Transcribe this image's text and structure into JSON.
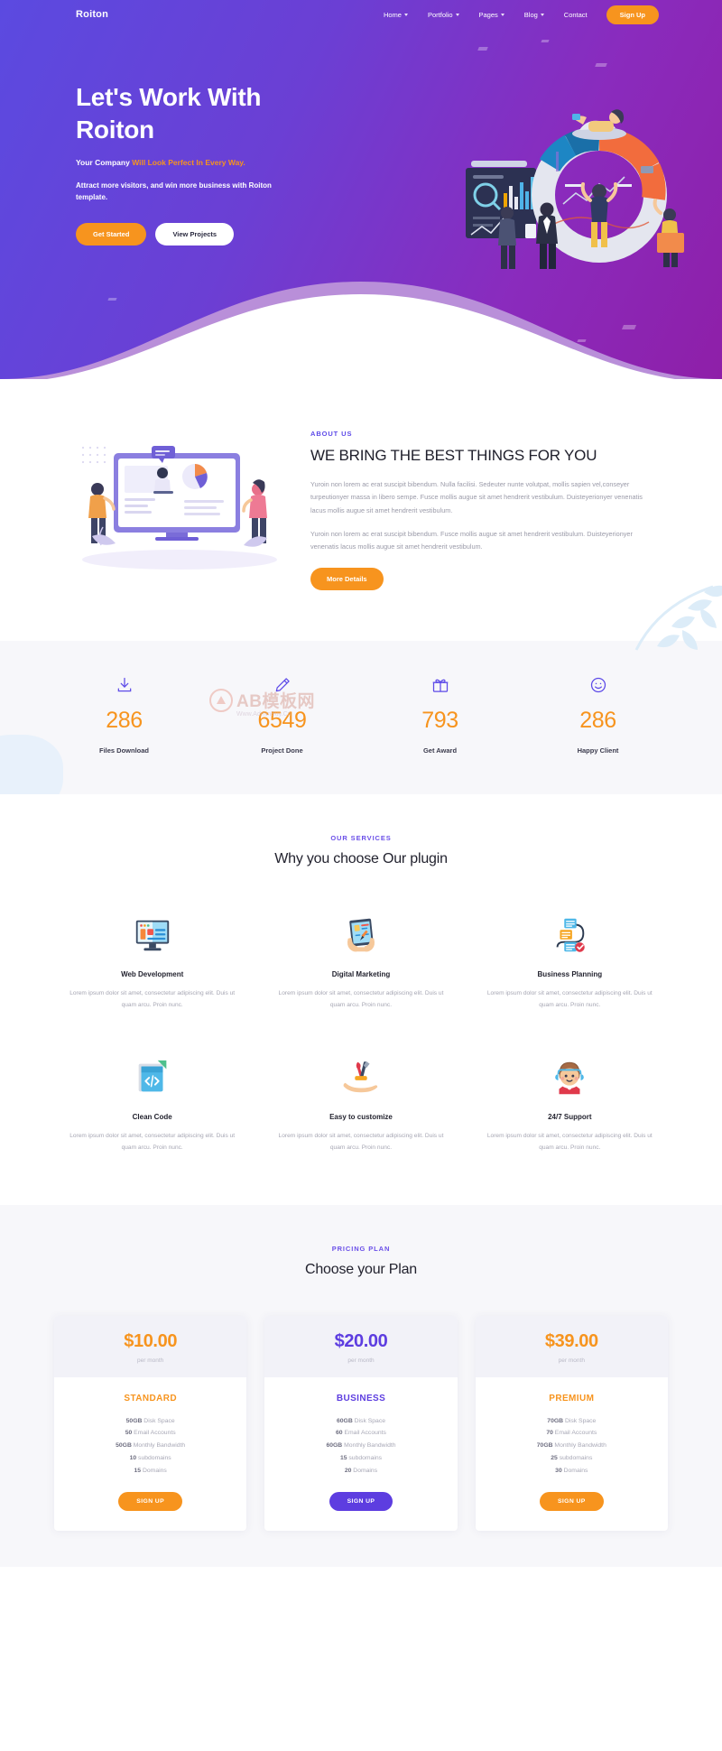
{
  "colors": {
    "orange": "#f7941e",
    "purple": "#5d4ae8",
    "deep_purple": "#6b3fd4",
    "magenta": "#8e1fa8",
    "heading": "#22222e",
    "muted": "#a6a6b3"
  },
  "nav": {
    "brand": "Roiton",
    "items": [
      {
        "label": "Home",
        "has_caret": true
      },
      {
        "label": "Portfolio",
        "has_caret": true
      },
      {
        "label": "Pages",
        "has_caret": true
      },
      {
        "label": "Blog",
        "has_caret": true
      },
      {
        "label": "Contact",
        "has_caret": false
      }
    ],
    "signup_label": "Sign Up"
  },
  "hero": {
    "title_line1": "Let's Work With",
    "title_line2": "Roiton",
    "sub_plain": "Your Company ",
    "sub_accent": "Will Look Perfect In Every Way.",
    "description": "Attract more visitors, and win more business with Roiton template.",
    "primary_button": "Get Started",
    "secondary_button": "View Projects",
    "illustration_name": "business-analytics-donut-chart-illustration"
  },
  "about": {
    "eyebrow": "ABOUT US",
    "heading": "WE BRING THE BEST THINGS FOR YOU",
    "paragraph1": "Yuroin non lorem ac erat suscipit bibendum. Nulla facilisi. Sedeuter nunte volutpat, mollis sapien vel,conseyer turpeutionyer massa in libero sempe. Fusce mollis augue sit amet hendrerit vestibulum. Duisteyerionyer venenatis lacus mollis augue sit amet hendrerit vestibulum.",
    "paragraph2": "Yuroin non lorem ac erat suscipit bibendum. Fusce mollis augue sit amet hendrerit vestibulum. Duisteyerionyer venenatis lacus mollis augue sit amet hendrerit vestibulum.",
    "button": "More Details",
    "illustration_name": "team-video-conference-illustration"
  },
  "counters": {
    "items": [
      {
        "icon": "download-icon",
        "value": "286",
        "label": "Files Download"
      },
      {
        "icon": "pencil-icon",
        "value": "6549",
        "label": "Project Done"
      },
      {
        "icon": "gift-icon",
        "value": "793",
        "label": "Get Award"
      },
      {
        "icon": "smiley-icon",
        "value": "286",
        "label": "Happy Client"
      }
    ],
    "watermark_text": "AB模板网",
    "watermark_url": "Www.AdminBuy.Cn"
  },
  "services": {
    "eyebrow": "OUR SERVICES",
    "title": "Why you choose Our plugin",
    "items": [
      {
        "icon": "monitor-webpage-icon",
        "title": "Web Development",
        "desc": "Lorem ipsum dolor sit amet, consectetur adipiscing elit. Duis ut quam arcu. Proin nunc."
      },
      {
        "icon": "tablet-hands-icon",
        "title": "Digital Marketing",
        "desc": "Lorem ipsum dolor sit amet, consectetur adipiscing elit. Duis ut quam arcu. Proin nunc."
      },
      {
        "icon": "flowchart-icon",
        "title": "Business Planning",
        "desc": "Lorem ipsum dolor sit amet, consectetur adipiscing elit. Duis ut quam arcu. Proin nunc."
      },
      {
        "icon": "code-document-icon",
        "title": "Clean Code",
        "desc": "Lorem ipsum dolor sit amet, consectetur adipiscing elit. Duis ut quam arcu. Proin nunc."
      },
      {
        "icon": "hand-tools-icon",
        "title": "Easy to customize",
        "desc": "Lorem ipsum dolor sit amet, consectetur adipiscing elit. Duis ut quam arcu. Proin nunc."
      },
      {
        "icon": "support-agent-icon",
        "title": "24/7 Support",
        "desc": "Lorem ipsum dolor sit amet, consectetur adipiscing elit. Duis ut quam arcu. Proin nunc."
      }
    ]
  },
  "pricing": {
    "eyebrow": "PRICING PLAN",
    "title": "Choose your Plan",
    "plans": [
      {
        "price": "$10.00",
        "period": "per month",
        "name": "STANDARD",
        "color": "#f7941e",
        "features": [
          {
            "strong": "50GB",
            "rest": " Disk Space"
          },
          {
            "strong": "50",
            "rest": " Email Accounts"
          },
          {
            "strong": "50GB",
            "rest": " Monthly Bandwidth"
          },
          {
            "strong": "10",
            "rest": " subdomains"
          },
          {
            "strong": "15",
            "rest": " Domains"
          }
        ],
        "button": "SIGN UP"
      },
      {
        "price": "$20.00",
        "period": "per month",
        "name": "BUSINESS",
        "color": "#5d3de0",
        "features": [
          {
            "strong": "60GB",
            "rest": " Disk Space"
          },
          {
            "strong": "60",
            "rest": " Email Accounts"
          },
          {
            "strong": "60GB",
            "rest": " Monthly Bandwidth"
          },
          {
            "strong": "15",
            "rest": " subdomains"
          },
          {
            "strong": "20",
            "rest": " Domains"
          }
        ],
        "button": "SIGN UP"
      },
      {
        "price": "$39.00",
        "period": "per month",
        "name": "PREMIUM",
        "color": "#f7941e",
        "features": [
          {
            "strong": "70GB",
            "rest": " Disk Space"
          },
          {
            "strong": "70",
            "rest": " Email Accounts"
          },
          {
            "strong": "70GB",
            "rest": " Monthly Bandwidth"
          },
          {
            "strong": "25",
            "rest": " subdomains"
          },
          {
            "strong": "30",
            "rest": " Domains"
          }
        ],
        "button": "SIGN UP"
      }
    ]
  }
}
